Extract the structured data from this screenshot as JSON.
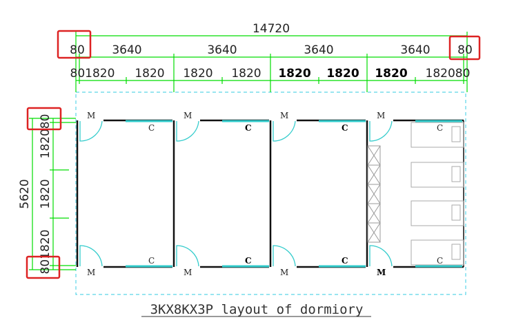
{
  "colors": {
    "dimension": "#00dd00",
    "highlight": "#dd2222",
    "door": "#33cccc",
    "outline": "#5ad5e8",
    "wall": "#111111"
  },
  "dimensions": {
    "top_total": "14720",
    "top_row1": [
      "80",
      "3640",
      "3640",
      "3640",
      "3640",
      "80"
    ],
    "top_row2": [
      "801820",
      "1820",
      "1820",
      "1820",
      "1820",
      "1820",
      "1820",
      "182080"
    ],
    "left_total": "5620",
    "left_segments": [
      "80",
      "1820",
      "1820",
      "1820",
      "80"
    ],
    "left_top_combined": "182080",
    "left_bottom_combined": "801820"
  },
  "labels": {
    "door_marker": "M",
    "window_marker": "C"
  },
  "caption": "3KX8KX3P layout of dormiory",
  "highlighted_values": [
    "80",
    "80",
    "80",
    "80"
  ]
}
